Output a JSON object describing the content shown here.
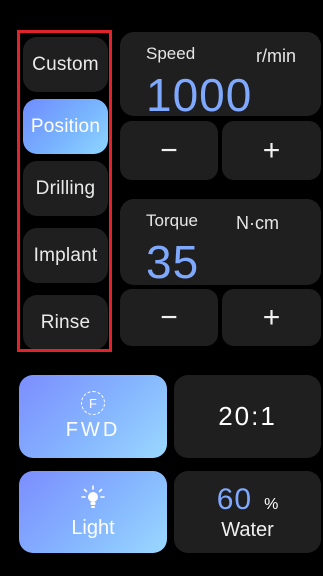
{
  "modes": [
    {
      "label": "Custom",
      "active": false
    },
    {
      "label": "Position",
      "active": true
    },
    {
      "label": "Drilling",
      "active": false
    },
    {
      "label": "Implant",
      "active": false
    },
    {
      "label": "Rinse",
      "active": false
    }
  ],
  "speed": {
    "label": "Speed",
    "unit": "r/min",
    "value": "1000",
    "minus": "−",
    "plus": "+"
  },
  "torque": {
    "label": "Torque",
    "unit": "N·cm",
    "value": "35",
    "minus": "−",
    "plus": "+"
  },
  "direction": {
    "icon_letter": "F",
    "label": "FWD",
    "icon": "forward-circle-icon"
  },
  "ratio": {
    "label": "20:1"
  },
  "light": {
    "label": "Light",
    "icon": "lightbulb-icon"
  },
  "water": {
    "value": "60",
    "unit": "%",
    "label": "Water"
  },
  "colors": {
    "accent": "#7fa9ff",
    "highlight": "#e0242c",
    "panel": "#1f1f1f",
    "background": "#000000"
  }
}
